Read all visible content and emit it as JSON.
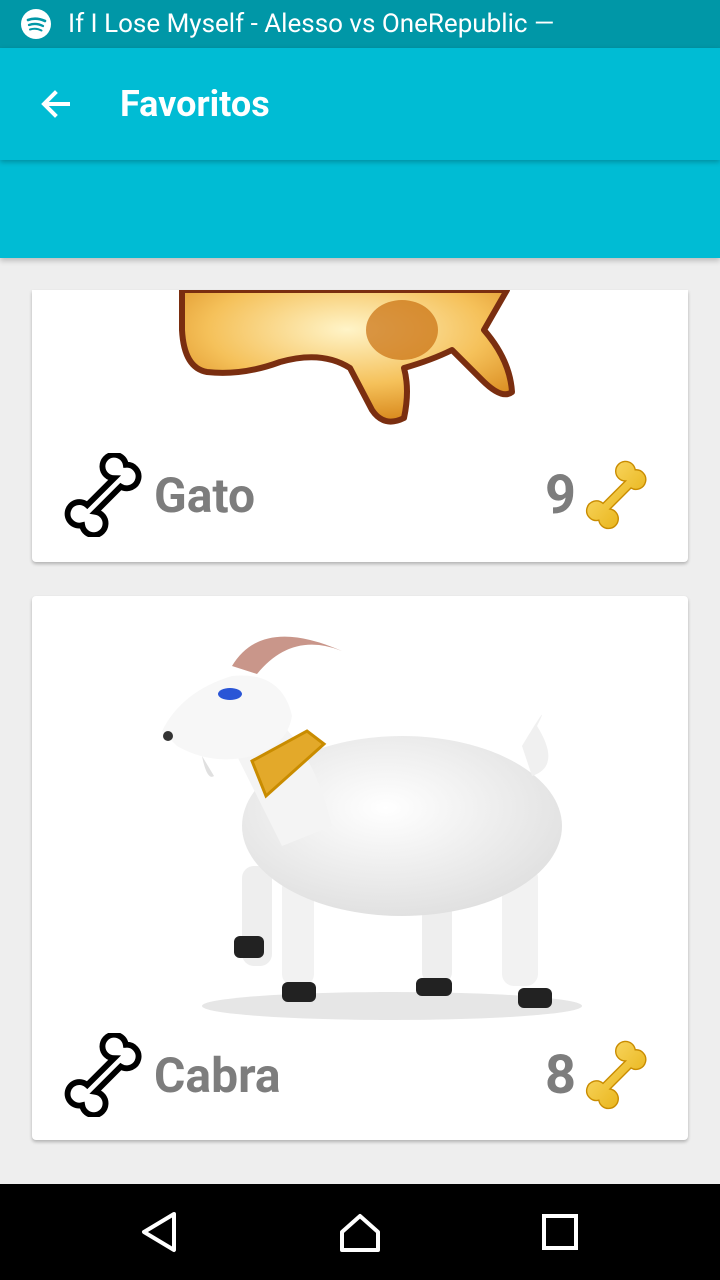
{
  "status_bar": {
    "app_icon": "spotify-icon",
    "notification_text": "If I Lose Myself - Alesso vs OneRepublic —"
  },
  "app_bar": {
    "back_icon": "arrow-back-icon",
    "title": "Favoritos",
    "color": "#00bcd4"
  },
  "favorites": [
    {
      "name": "Gato",
      "count": "9",
      "image": "cat-illustration",
      "fav_icon": "bone-outline-icon",
      "count_icon": "gold-bone-icon"
    },
    {
      "name": "Cabra",
      "count": "8",
      "image": "goat-illustration",
      "fav_icon": "bone-outline-icon",
      "count_icon": "gold-bone-icon"
    }
  ],
  "nav_bar": {
    "buttons": [
      "back-triangle-icon",
      "home-icon",
      "recents-square-icon"
    ]
  }
}
